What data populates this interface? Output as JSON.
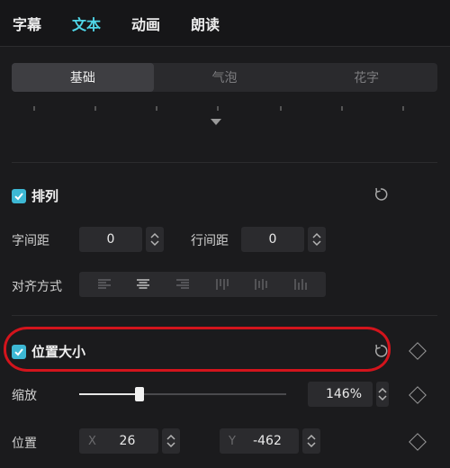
{
  "tabs": [
    {
      "label": "字幕",
      "active": false
    },
    {
      "label": "文本",
      "active": true
    },
    {
      "label": "动画",
      "active": false
    },
    {
      "label": "朗读",
      "active": false
    }
  ],
  "subtabs": [
    {
      "label": "基础",
      "active": true
    },
    {
      "label": "气泡",
      "active": false
    },
    {
      "label": "花字",
      "active": false
    }
  ],
  "arrangement": {
    "title": "排列",
    "checked": true,
    "char_spacing_label": "字间距",
    "char_spacing_value": "0",
    "line_spacing_label": "行间距",
    "line_spacing_value": "0",
    "alignment_label": "对齐方式"
  },
  "position_size": {
    "title": "位置大小",
    "checked": true,
    "scale_label": "缩放",
    "scale_value": "146%",
    "scale_fraction": 0.29,
    "position_label": "位置",
    "x_prefix": "X",
    "x_value": "26",
    "y_prefix": "Y",
    "y_value": "-462"
  },
  "colors": {
    "accent": "#4fd5e6",
    "checkbox": "#3db8d4",
    "annotation": "#d3141c"
  }
}
